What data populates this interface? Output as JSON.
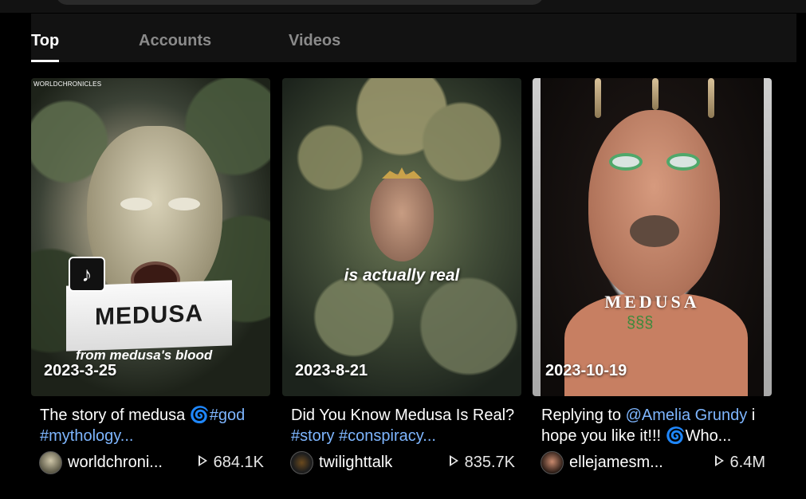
{
  "tabs": [
    {
      "label": "Top",
      "active": true
    },
    {
      "label": "Accounts",
      "active": false
    },
    {
      "label": "Videos",
      "active": false
    }
  ],
  "cards": [
    {
      "date": "2023-3-25",
      "watermark": "WORLDCHRONICLES",
      "overlay_title": "MEDUSA",
      "overlay_sub": "from medusa's blood",
      "desc_text": "The story of medusa ",
      "desc_tag1": "#god",
      "desc_tag2": "#mythology...",
      "author": "worldchroni...",
      "views": "684.1K"
    },
    {
      "date": "2023-8-21",
      "overlay_caption": "is actually real",
      "desc_text": "Did You Know Medusa Is Real? ",
      "desc_tag1": "#story",
      "desc_tag2": "#conspiracy...",
      "author": "twilighttalk",
      "views": "835.7K"
    },
    {
      "date": "2023-10-19",
      "overlay_title": "MEDUSA",
      "desc_prefix": "Replying to ",
      "desc_mention": "@Amelia Grundy",
      "desc_text": " i hope you like it!!! ",
      "desc_suffix": "Who...",
      "author": "ellejamesm...",
      "views": "6.4M"
    }
  ],
  "icons": {
    "spiral": "🌀",
    "play": "play-icon",
    "tiktok_logo": "♪"
  },
  "colors": {
    "background": "#000000",
    "tabbar": "#121212",
    "hashtag": "#7eb6ff",
    "spiral_icon": "#2ec27e"
  }
}
